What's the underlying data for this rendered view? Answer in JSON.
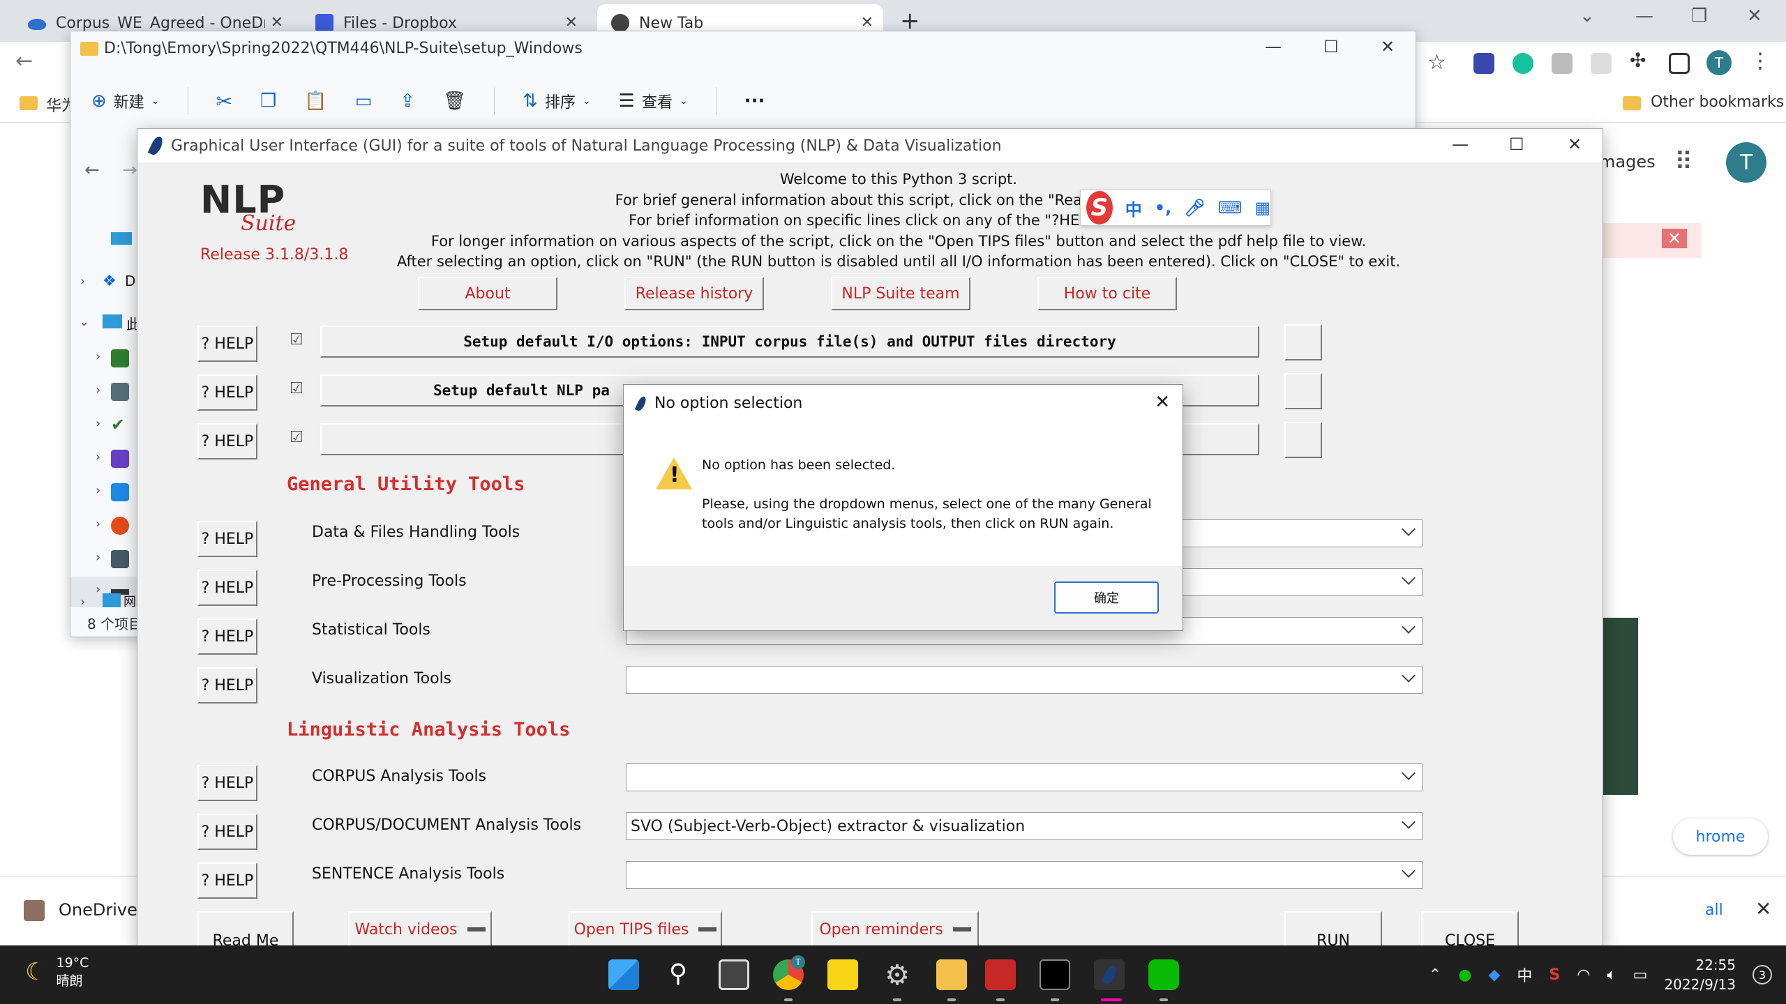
{
  "chrome": {
    "tabs": [
      {
        "label": "Corpus_WE_Agreed - OneDrive"
      },
      {
        "label": "Files - Dropbox"
      },
      {
        "label": "New Tab"
      }
    ],
    "bookmarks": {
      "first": "华为",
      "other": "Other bookmarks"
    },
    "page": {
      "images_link": "mages",
      "avatar": "T",
      "chrome_btn": "hrome",
      "see_all": "all"
    },
    "downloads": {
      "item": "OneDrive_"
    },
    "colors": {
      "tabbar": "#dfe3e8",
      "accent": "#1a73e8"
    }
  },
  "explorer": {
    "path": "D:\\Tong\\Emory\\Spring2022\\QTM446\\NLP-Suite\\setup_Windows",
    "cmd": {
      "new": "新建",
      "sort": "排序",
      "view": "查看",
      "more": "···"
    },
    "tree": {
      "item1": "D",
      "item2": "此",
      "item_net": "网"
    },
    "status": "8 个项目"
  },
  "nlp": {
    "title": "Graphical User Interface (GUI) for a suite of tools of Natural Language Processing (NLP) & Data Visualization",
    "logo": {
      "nlp": "NLP",
      "suite": "Suite",
      "release": "Release 3.1.8/3.1.8"
    },
    "welcome": [
      "Welcome to this Python 3 script.",
      "For brief general information about this script, click on the \"Read Me\" button.",
      "For brief information on specific lines click on any of the \"?HELP\" buttons.",
      "For longer information on various aspects of the script, click on the \"Open TIPS files\" button and select the pdf help file to view.",
      "After selecting an option, click on \"RUN\" (the RUN button is disabled until all I/O information has been entered).   Click on \"CLOSE\" to exit."
    ],
    "top_buttons": [
      "About",
      "Release history",
      "NLP Suite team",
      "How to cite"
    ],
    "help_label": "? HELP",
    "check_glyph": "☑",
    "setup_rows": [
      "Setup default I/O options: INPUT corpus file(s) and OUTPUT files directory",
      "Setup default NLP pa",
      ""
    ],
    "general_title": "General Utility Tools",
    "general_tools": [
      {
        "label": "Data & Files Handling Tools",
        "value": ""
      },
      {
        "label": "Pre-Processing Tools",
        "value": ""
      },
      {
        "label": "Statistical Tools",
        "value": ""
      },
      {
        "label": "Visualization Tools",
        "value": ""
      }
    ],
    "linguistic_title": "Linguistic Analysis Tools",
    "linguistic_tools": [
      {
        "label": "CORPUS Analysis Tools",
        "value": ""
      },
      {
        "label": "CORPUS/DOCUMENT Analysis Tools",
        "value": "SVO (Subject-Verb-Object) extractor & visualization"
      },
      {
        "label": "SENTENCE Analysis Tools",
        "value": ""
      }
    ],
    "bottom_buttons": {
      "readme": "Read Me",
      "videos": "Watch videos",
      "tips": "Open TIPS files",
      "reminders": "Open reminders",
      "run": "RUN",
      "close": "CLOSE"
    },
    "colors": {
      "red": "#c62828",
      "section": "#d32f2f"
    }
  },
  "dialog": {
    "title": "No option selection",
    "line1": "No option has been selected.",
    "line2": "Please, using the dropdown menus, select one of the many General",
    "line3": "tools and/or Linguistic analysis tools, then click on RUN again.",
    "ok": "确定"
  },
  "ime": {
    "s": "S",
    "zh": "中",
    "punct": "•,"
  },
  "taskbar": {
    "temp": "19°C",
    "weather": "晴朗",
    "ime_lang": "中",
    "time": "22:55",
    "date": "2022/9/13",
    "notifications": "3",
    "chrome_badge": "T"
  }
}
